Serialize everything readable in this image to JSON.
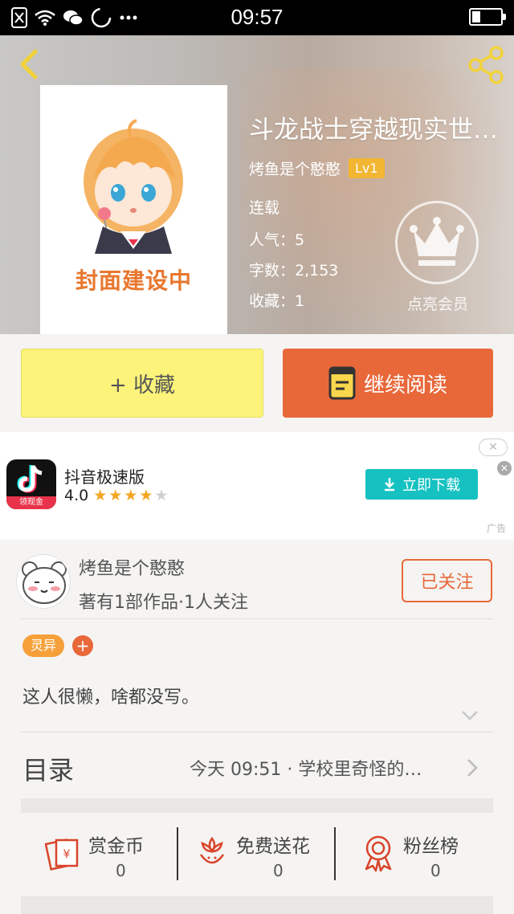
{
  "status_bar": {
    "time": "09:57"
  },
  "book": {
    "title": "斗龙战士穿越现实世…",
    "cover_text": "封面建设中",
    "author": "烤鱼是个憨憨",
    "author_level": "Lv1",
    "status": "连载",
    "popularity": "人气：5",
    "word_count": "字数：2,153",
    "favorites": "收藏：1",
    "vip_label": "点亮会员"
  },
  "actions": {
    "favorite_label": "+ 收藏",
    "read_label": "继续阅读"
  },
  "ad": {
    "app_name": "抖音极速版",
    "rating": "4.0",
    "stars_filled": 4,
    "icon_tag": "领现金",
    "download_label": "立即下载",
    "close_symbol": "✕",
    "ad_label": "广告"
  },
  "author_section": {
    "name": "烤鱼是个憨憨",
    "works": "著有1部作品·1人关注",
    "follow_label": "已关注",
    "genre_tag": "灵异",
    "add_tag": "+",
    "bio": "这人很懒，啥都没写。"
  },
  "toc": {
    "title": "目录",
    "latest": "今天 09:51 · 学校里奇怪的…"
  },
  "stats": [
    {
      "label": "赏金币",
      "value": "0"
    },
    {
      "label": "免费送花",
      "value": "0"
    },
    {
      "label": "粉丝榜",
      "value": "0"
    }
  ],
  "colors": {
    "accent": "#e8683a",
    "favorite_button": "#fbf37a",
    "download_button": "#16c1c1",
    "level_badge": "#f2b632"
  }
}
